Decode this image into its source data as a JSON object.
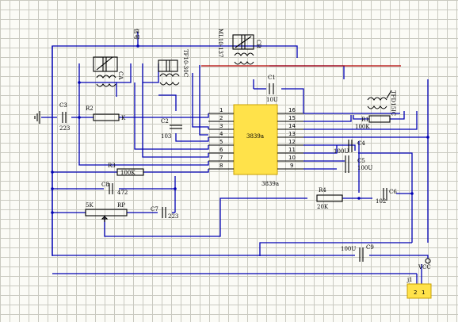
{
  "chip": {
    "name": "3839a",
    "footer": "3839a",
    "left_pins": [
      "1",
      "2",
      "3",
      "4",
      "5",
      "6",
      "7",
      "8"
    ],
    "right_pins": [
      "16",
      "15",
      "14",
      "13",
      "12",
      "11",
      "10",
      "9"
    ]
  },
  "labels": {
    "c1": "C1",
    "c1v": "10U",
    "c2": "C2",
    "c2v": "103",
    "c3": "C3",
    "c3v": "223",
    "c4": "C4",
    "c4v": "100U",
    "c5": "C5",
    "c5v": "100U",
    "c6": "C6",
    "c6v": "102",
    "c7": "C7",
    "c7v": "223",
    "c8": "C8",
    "c8v": "472",
    "c9": "C9",
    "c9v": "100U",
    "r1": "R1",
    "r1v": "100K",
    "r2": "R2",
    "r2v": "K",
    "r3": "R3",
    "r3v": "100K",
    "r4": "R4",
    "r4v": "20K",
    "rp": "RP",
    "rpv": "5K",
    "ca": "CA",
    "cb": "CB",
    "t_mid": "TF10-30C",
    "t_top": "ML10-137",
    "t_right": "TFD15IC",
    "signal": "信号",
    "vcc": "VCC",
    "j1": "j1",
    "j1p2": "2",
    "j1p1": "1"
  }
}
